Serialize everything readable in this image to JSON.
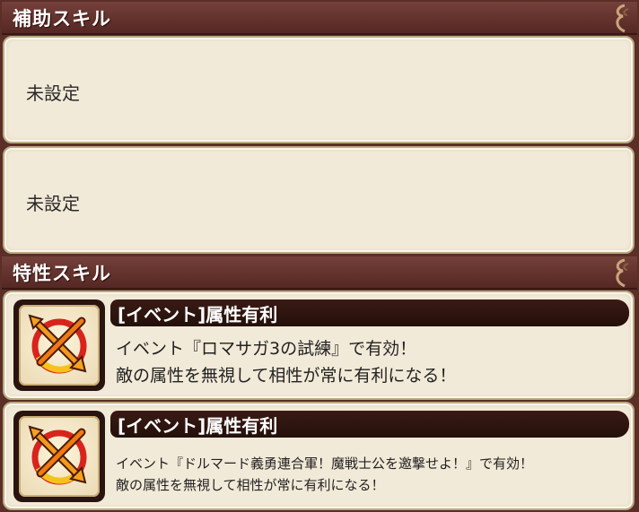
{
  "support": {
    "header": "補助スキル",
    "slots": [
      {
        "label": "未設定"
      },
      {
        "label": "未設定"
      }
    ]
  },
  "trait": {
    "header": "特性スキル",
    "cards": [
      {
        "icon": "crossed-arrows-icon",
        "name": "[イベント]属性有利",
        "lines": [
          "イベント『ロマサガ3の試練』で有効！",
          "敵の属性を無視して相性が常に有利になる！"
        ]
      },
      {
        "icon": "crossed-arrows-icon",
        "name": "[イベント]属性有利",
        "lines": [
          "イベント『ドルマード義勇連合軍！魔戦士公を邀撃せよ！』で有効！",
          "敵の属性を無視して相性が常に有利になる！"
        ]
      }
    ]
  },
  "colors": {
    "header_bg": "#62312c",
    "panel_bg": "#f2ead8",
    "skill_bar_bg": "#2a1410",
    "icon_red": "#d8241c",
    "icon_orange": "#f29a1d"
  }
}
